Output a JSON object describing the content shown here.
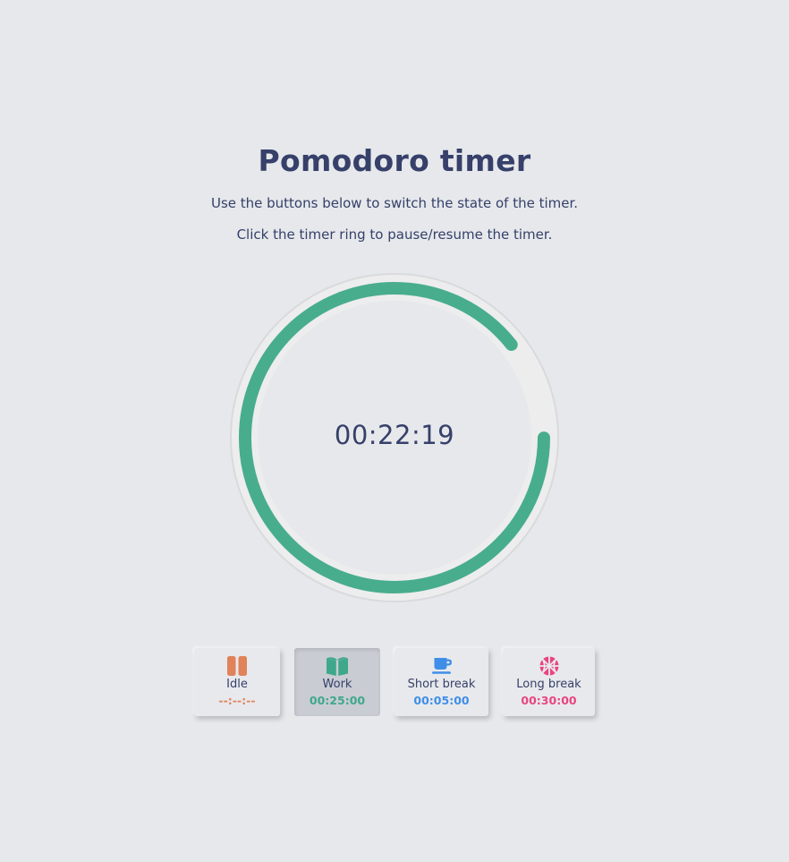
{
  "title": "Pomodoro timer",
  "instructions": [
    "Use the buttons below to switch the state of the timer.",
    "Click the timer ring to pause/resume the timer."
  ],
  "timer": {
    "display": "00:22:19",
    "progress_fraction": 0.893,
    "active_color": "#48ad8d"
  },
  "states": [
    {
      "label": "Idle",
      "time": "--:--:--",
      "icon": "pause-icon",
      "color": "#e0825a",
      "active": false
    },
    {
      "label": "Work",
      "time": "00:25:00",
      "icon": "book-icon",
      "color": "#3fa88a",
      "active": true
    },
    {
      "label": "Short break",
      "time": "00:05:00",
      "icon": "coffee-icon",
      "color": "#3f8ee8",
      "active": false
    },
    {
      "label": "Long break",
      "time": "00:30:00",
      "icon": "basketball-icon",
      "color": "#e8457f",
      "active": false
    }
  ]
}
